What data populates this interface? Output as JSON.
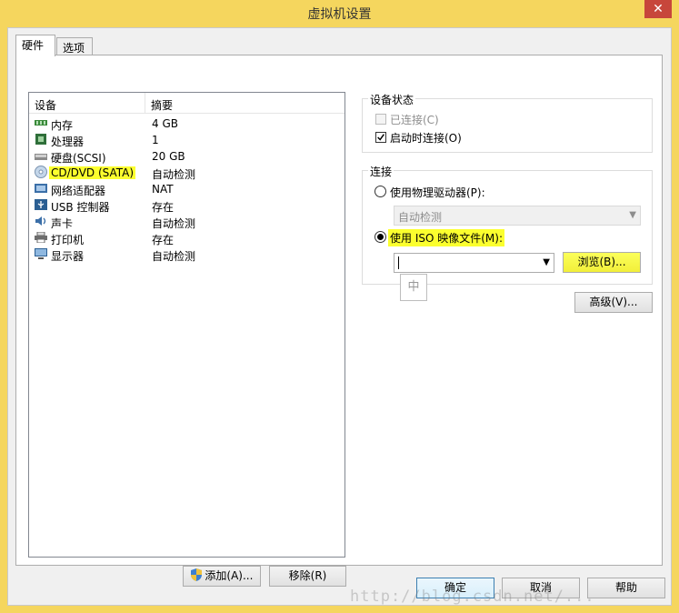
{
  "window": {
    "title": "虚拟机设置",
    "close_glyph": "✕"
  },
  "tabs": [
    {
      "label": "硬件"
    },
    {
      "label": "选项"
    }
  ],
  "device_list": {
    "headers": {
      "device": "设备",
      "summary": "摘要"
    },
    "rows": [
      {
        "name": "内存",
        "summary": "4 GB",
        "icon": "memory-icon"
      },
      {
        "name": "处理器",
        "summary": "1",
        "icon": "processor-icon"
      },
      {
        "name": "硬盘(SCSI)",
        "summary": "20 GB",
        "icon": "harddisk-icon"
      },
      {
        "name": "CD/DVD (SATA)",
        "summary": "自动检测",
        "icon": "cd-dvd-icon",
        "selected": true
      },
      {
        "name": "网络适配器",
        "summary": "NAT",
        "icon": "network-adapter-icon"
      },
      {
        "name": "USB 控制器",
        "summary": "存在",
        "icon": "usb-icon"
      },
      {
        "name": "声卡",
        "summary": "自动检测",
        "icon": "sound-card-icon"
      },
      {
        "name": "打印机",
        "summary": "存在",
        "icon": "printer-icon"
      },
      {
        "name": "显示器",
        "summary": "自动检测",
        "icon": "display-icon"
      }
    ]
  },
  "buttons": {
    "add": "添加(A)...",
    "remove": "移除(R)",
    "browse": "浏览(B)...",
    "advanced": "高级(V)...",
    "ok": "确定",
    "cancel": "取消",
    "help": "帮助"
  },
  "device_status": {
    "legend": "设备状态",
    "connected_label": "已连接(C)",
    "connected_checked": false,
    "connected_enabled": false,
    "connect_at_power_on_label": "启动时连接(O)",
    "connect_at_power_on_checked": true
  },
  "connection": {
    "legend": "连接",
    "physical_drive_label": "使用物理驱动器(P):",
    "physical_drive_value": "自动检测",
    "iso_label": "使用 ISO 映像文件(M):",
    "iso_path_value": "",
    "selected": "iso"
  },
  "ime_indicator": "中",
  "watermark": "http://blog.csdn.net/..."
}
